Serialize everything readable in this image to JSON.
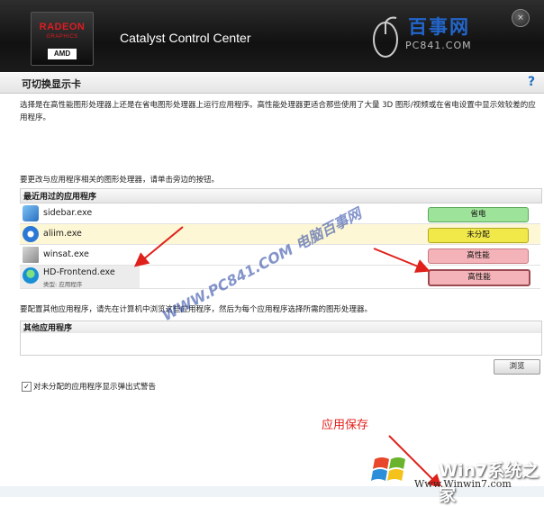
{
  "window": {
    "app_title": "Catalyst Control Center",
    "logo": {
      "radeon": "RADEON",
      "graphics": "GRAPHICS",
      "amd": "AMD"
    },
    "close_glyph": "×"
  },
  "watermark": {
    "site_cn": "百事网",
    "site_en": "PC841.COM",
    "diagonal": "WWW.PC841.COM 电脑百事网"
  },
  "section": {
    "title": "可切换显示卡",
    "help": "?",
    "description": "选择是在高性能图形处理器上还是在省电图形处理器上运行应用程序。高性能处理器更适合那些使用了大量 3D 图形/视频或在省电设置中显示效较差的应用程序。",
    "instruction": "要更改与应用程序相关的图形处理器，请单击旁边的按钮。"
  },
  "recent": {
    "title": "最近用过的应用程序",
    "rows": [
      {
        "name": "sidebar.exe",
        "sub": "",
        "gpu": "省电",
        "color": "#9ee39a",
        "icon": "sidebar-icon"
      },
      {
        "name": "aliim.exe",
        "sub": "",
        "gpu": "未分配",
        "color": "#f1e84a",
        "icon": "aliim-icon"
      },
      {
        "name": "winsat.exe",
        "sub": "",
        "gpu": "高性能",
        "color": "#f4b3b8",
        "icon": "winsat-icon"
      },
      {
        "name": "HD-Frontend.exe",
        "sub": "类型: 应用程序",
        "gpu": "高性能",
        "color": "#f4b3b8",
        "icon": "hd-frontend-icon"
      }
    ]
  },
  "other": {
    "label": "要配置其他应用程序，请先在计算机中浏览这些应用程序，然后为每个应用程序选择所需的图形处理器。",
    "title": "其他应用程序",
    "browse": "浏览"
  },
  "checkbox": {
    "checked": true,
    "mark": "✓",
    "label": "对未分配的应用程序显示弹出式警告"
  },
  "annotations": {
    "save": "应用保存",
    "arrow_color": "#e0201b"
  },
  "win7": {
    "cn": "Win7系统之家",
    "en": "Www.Winwin7.com"
  }
}
